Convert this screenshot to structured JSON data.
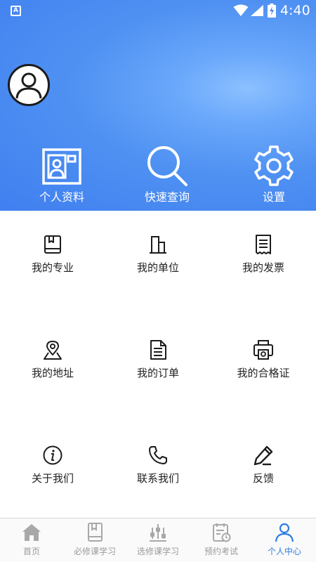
{
  "status_bar": {
    "time": "4:40",
    "app_icon_letter": "A"
  },
  "header": {
    "quick_actions": [
      {
        "label": "个人资料",
        "icon": "profile-card-icon"
      },
      {
        "label": "快速查询",
        "icon": "search-icon"
      },
      {
        "label": "设置",
        "icon": "gear-icon"
      }
    ]
  },
  "menu": {
    "items": [
      {
        "label": "我的专业",
        "icon": "book-icon"
      },
      {
        "label": "我的单位",
        "icon": "building-icon"
      },
      {
        "label": "我的发票",
        "icon": "invoice-icon"
      },
      {
        "label": "我的地址",
        "icon": "location-pin-icon"
      },
      {
        "label": "我的订单",
        "icon": "document-icon"
      },
      {
        "label": "我的合格证",
        "icon": "printer-icon"
      },
      {
        "label": "关于我们",
        "icon": "info-icon"
      },
      {
        "label": "联系我们",
        "icon": "phone-icon"
      },
      {
        "label": "反馈",
        "icon": "pencil-icon"
      }
    ]
  },
  "tabbar": {
    "active_index": 4,
    "active_color": "#2f7be5",
    "inactive_color": "#9a9a9a",
    "tabs": [
      {
        "label": "首页",
        "icon": "home-icon"
      },
      {
        "label": "必修课学习",
        "icon": "book-icon"
      },
      {
        "label": "选修课学习",
        "icon": "sliders-icon"
      },
      {
        "label": "预约考试",
        "icon": "calendar-clock-icon"
      },
      {
        "label": "个人中心",
        "icon": "user-icon"
      }
    ]
  }
}
